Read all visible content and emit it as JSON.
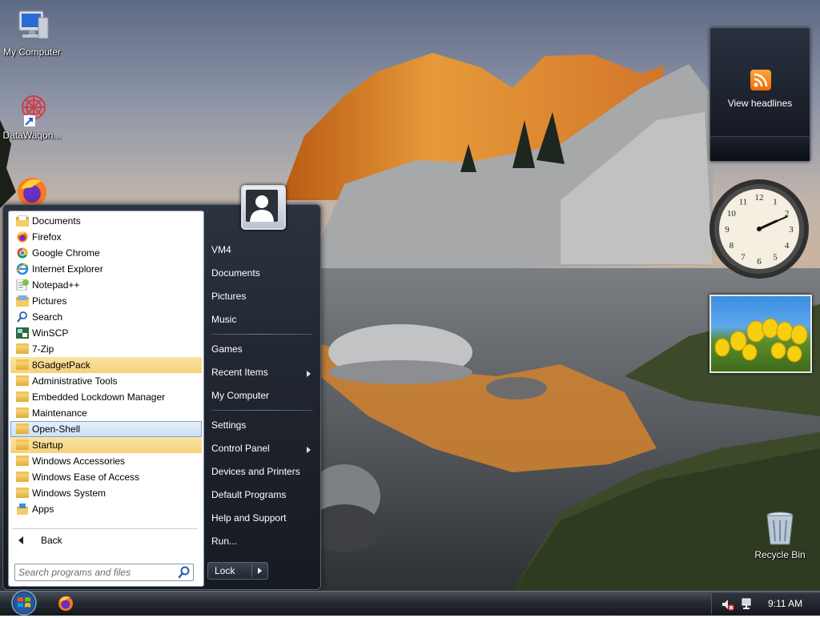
{
  "desktop": {
    "icons": [
      {
        "label": "My Computer"
      },
      {
        "label": "DataWagon..."
      },
      {
        "label": "Recycle Bin"
      }
    ]
  },
  "gadgets": {
    "rss": {
      "label": "View headlines",
      "icon": "rss-icon"
    },
    "clock": {
      "hour": 2,
      "minute": 11,
      "numbers": [
        "12",
        "1",
        "2",
        "3",
        "4",
        "5",
        "6",
        "7",
        "8",
        "9",
        "10",
        "11"
      ]
    },
    "slideshow": {
      "subject": "yellow tulips"
    }
  },
  "start_menu": {
    "programs": [
      {
        "label": "Documents",
        "icon": "folder-documents-icon"
      },
      {
        "label": "Firefox",
        "icon": "firefox-icon"
      },
      {
        "label": "Google Chrome",
        "icon": "chrome-icon"
      },
      {
        "label": "Internet Explorer",
        "icon": "internet-explorer-icon"
      },
      {
        "label": "Notepad++",
        "icon": "notepad-plus-plus-icon"
      },
      {
        "label": "Pictures",
        "icon": "folder-pictures-icon"
      },
      {
        "label": "Search",
        "icon": "search-icon"
      },
      {
        "label": "WinSCP",
        "icon": "winscp-icon"
      },
      {
        "label": "7-Zip",
        "icon": "folder-icon"
      },
      {
        "label": "8GadgetPack",
        "icon": "folder-icon",
        "state": "highlighted"
      },
      {
        "label": "Administrative Tools",
        "icon": "folder-icon"
      },
      {
        "label": "Embedded Lockdown Manager",
        "icon": "folder-icon"
      },
      {
        "label": "Maintenance",
        "icon": "folder-icon"
      },
      {
        "label": "Open-Shell",
        "icon": "folder-icon",
        "state": "selected"
      },
      {
        "label": "Startup",
        "icon": "folder-icon",
        "state": "highlighted"
      },
      {
        "label": "Windows Accessories",
        "icon": "folder-icon"
      },
      {
        "label": "Windows Ease of Access",
        "icon": "folder-icon"
      },
      {
        "label": "Windows System",
        "icon": "folder-icon"
      },
      {
        "label": "Apps",
        "icon": "apps-icon"
      }
    ],
    "back_label": "Back",
    "search_placeholder": "Search programs and files",
    "right_items": [
      {
        "label": "VM4"
      },
      {
        "label": "Documents"
      },
      {
        "label": "Pictures"
      },
      {
        "label": "Music"
      },
      {
        "separator": true
      },
      {
        "label": "Games"
      },
      {
        "label": "Recent Items",
        "submenu": true
      },
      {
        "label": "My Computer"
      },
      {
        "separator": true
      },
      {
        "label": "Settings"
      },
      {
        "label": "Control Panel",
        "submenu": true
      },
      {
        "label": "Devices and Printers"
      },
      {
        "label": "Default Programs"
      },
      {
        "label": "Help and Support"
      },
      {
        "label": "Run..."
      }
    ],
    "lock_label": "Lock"
  },
  "taskbar": {
    "pinned": [
      {
        "icon": "firefox-icon"
      }
    ],
    "tray": {
      "volume_icon": "volume-muted-icon",
      "network_icon": "network-icon",
      "time": "9:11 AM"
    }
  },
  "colors": {
    "highlight": "#f7d17a",
    "selected": "#cde0f6",
    "menu_dark": "#1d222b",
    "accent_orange": "#f06a00"
  }
}
